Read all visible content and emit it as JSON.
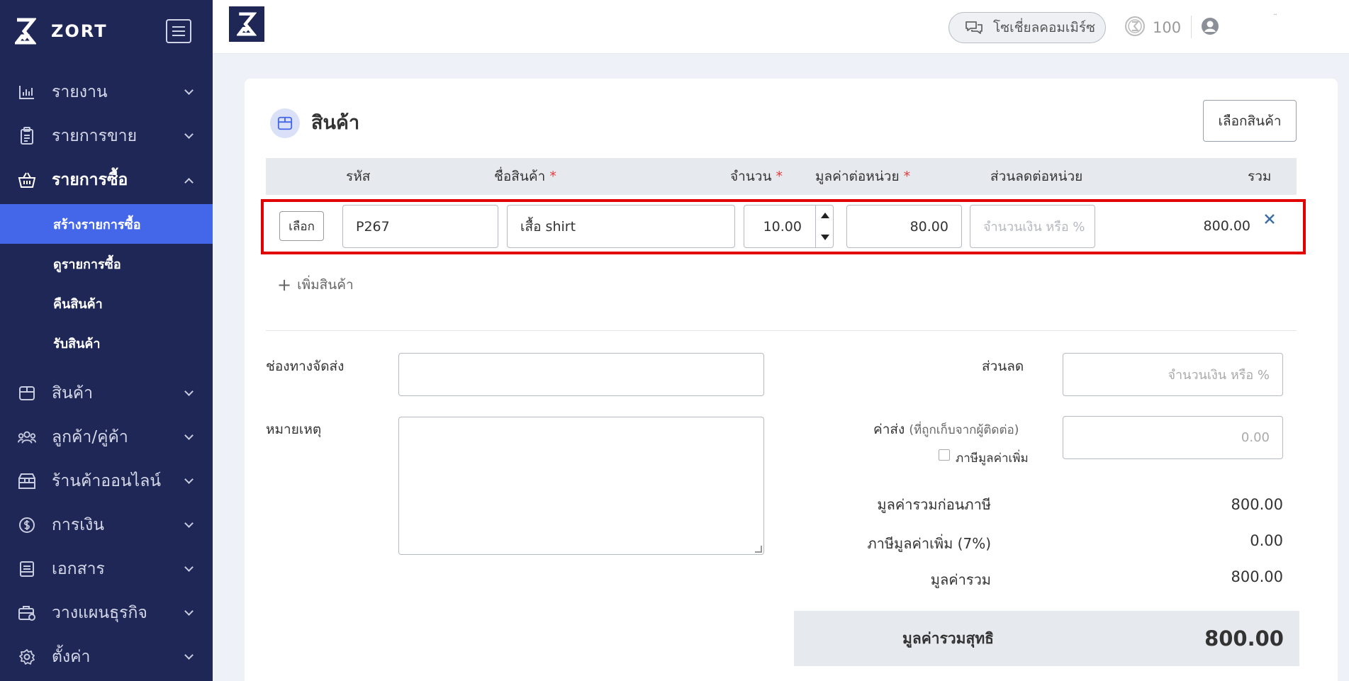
{
  "brand": {
    "name": "ZORT"
  },
  "sidebar": {
    "items": [
      {
        "label": "รายงาน",
        "icon": "chart-icon"
      },
      {
        "label": "รายการขาย",
        "icon": "clipboard-icon"
      },
      {
        "label": "รายการซื้อ",
        "icon": "basket-icon"
      },
      {
        "label": "สินค้า",
        "icon": "box-icon"
      },
      {
        "label": "ลูกค้า/คู่ค้า",
        "icon": "users-icon"
      },
      {
        "label": "ร้านค้าออนไลน์",
        "icon": "store-icon"
      },
      {
        "label": "การเงิน",
        "icon": "money-icon"
      },
      {
        "label": "เอกสาร",
        "icon": "document-icon"
      },
      {
        "label": "วางแผนธุรกิจ",
        "icon": "briefcase-icon"
      },
      {
        "label": "ตั้งค่า",
        "icon": "gear-icon"
      }
    ],
    "purchase_sub": [
      {
        "label": "สร้างรายการซื้อ"
      },
      {
        "label": "ดูรายการซื้อ"
      },
      {
        "label": "คืนสินค้า"
      },
      {
        "label": "รับสินค้า"
      }
    ]
  },
  "topbar": {
    "social_label": "โซเชี่ยลคอมเมิร์ซ",
    "credit": "100",
    "dots": "¨"
  },
  "product_section": {
    "title": "สินค้า",
    "select_button": "เลือกสินค้า",
    "columns": {
      "code": "รหัส",
      "name": "ชื่อสินค้า",
      "qty": "จำนวน",
      "unit_price": "มูลค่าต่อหน่วย",
      "discount": "ส่วนลดต่อหน่วย",
      "total": "รวม",
      "required_mark": "*"
    },
    "row": {
      "choose": "เลือก",
      "code": "P267",
      "name": "เสื้อ shirt",
      "qty": "10.00",
      "unit_price": "80.00",
      "discount_placeholder": "จำนวนเงิน หรือ %",
      "total": "800.00"
    },
    "add_label": "เพิ่มสินค้า"
  },
  "form": {
    "shipping_channel_label": "ช่องทางจัดส่ง",
    "note_label": "หมายเหตุ",
    "discount_label": "ส่วนลด",
    "discount_placeholder": "จำนวนเงิน หรือ %",
    "shipping_label": "ค่าส่ง",
    "shipping_sub": "(ที่ถูกเก็บจากผู้ติดต่อ)",
    "shipping_placeholder": "0.00",
    "vat_checkbox_label": "ภาษีมูลค่าเพิ่ม"
  },
  "summary": {
    "pre_tax_label": "มูลค่ารวมก่อนภาษี",
    "pre_tax_value": "800.00",
    "vat_label": "ภาษีมูลค่าเพิ่ม (7%)",
    "vat_value": "0.00",
    "total_label": "มูลค่ารวม",
    "total_value": "800.00",
    "net_label": "มูลค่ารวมสุทธิ",
    "net_value": "800.00"
  },
  "colors": {
    "sidebar_bg": "#1f2757",
    "active_sub_bg": "#4466e8",
    "highlight_border": "#e00000"
  }
}
